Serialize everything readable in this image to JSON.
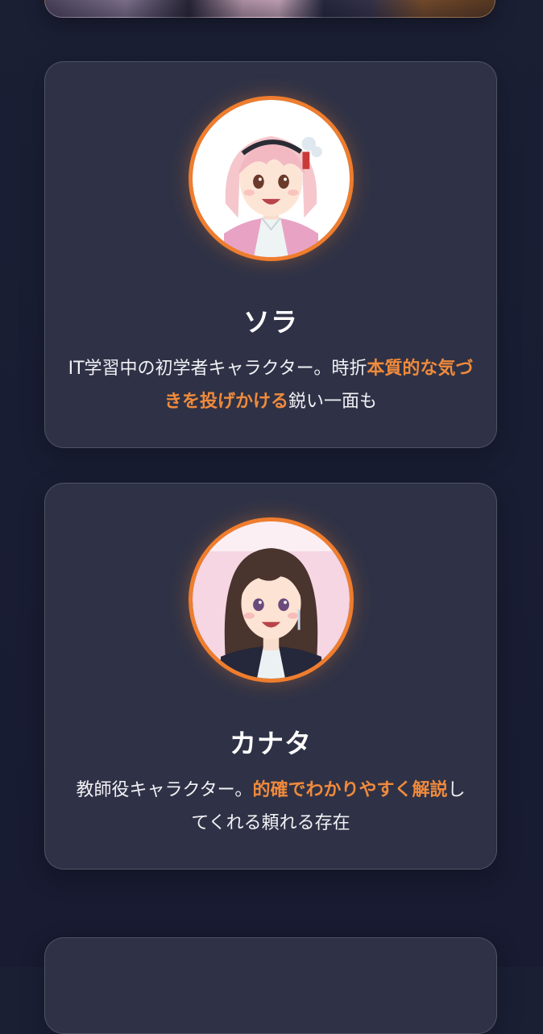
{
  "colors": {
    "background": "#1a1d33",
    "card": "#2f3246",
    "accent": "#ef7d2d",
    "highlight_text": "#f08a3c"
  },
  "characters": [
    {
      "name": "ソラ",
      "avatar_icon": "pink-haired-student-avatar",
      "description": {
        "before": "IT学習中の初学者キャラクター。時折",
        "highlight": "本質的な気づきを投げかける",
        "after": "鋭い一面も"
      }
    },
    {
      "name": "カナタ",
      "avatar_icon": "brown-haired-teacher-avatar",
      "description": {
        "before": "教師役キャラクター。",
        "highlight": "的確でわかりやすく解説",
        "after": "してくれる頼れる存在"
      }
    }
  ]
}
